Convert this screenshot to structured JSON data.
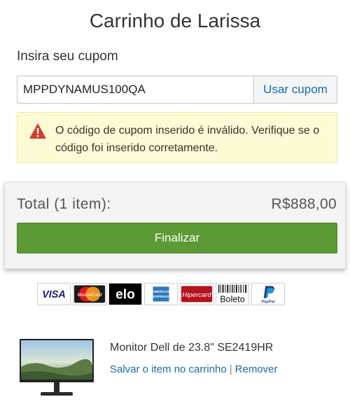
{
  "page": {
    "title": "Carrinho de Larissa"
  },
  "coupon": {
    "label": "Insira seu cupom",
    "value": "MPPDYNAMUS100QA",
    "apply_label": "Usar cupom"
  },
  "alert": {
    "icon": "warning-icon",
    "message": "O código de cupom inserido é inválido. Verifique se o código foi inserido corretamente."
  },
  "summary": {
    "total_label": "Total (1 item):",
    "total_value": "R$888,00",
    "checkout_label": "Finalizar"
  },
  "payment_methods": [
    {
      "name": "VISA"
    },
    {
      "name": "MasterCard"
    },
    {
      "name": "elo"
    },
    {
      "name": "American Express"
    },
    {
      "name": "Hipercard"
    },
    {
      "name": "Boleto"
    },
    {
      "name": "PayPal"
    }
  ],
  "item": {
    "name": "Monitor Dell de 23.8\" SE2419HR",
    "save_label": "Salvar o item no carrinho",
    "separator": "|",
    "remove_label": "Remover"
  },
  "colors": {
    "accent_link": "#1a6aa6",
    "checkout_green": "#5b9a35",
    "alert_background": "#fdfbd5",
    "alert_icon": "#d63b2a"
  }
}
